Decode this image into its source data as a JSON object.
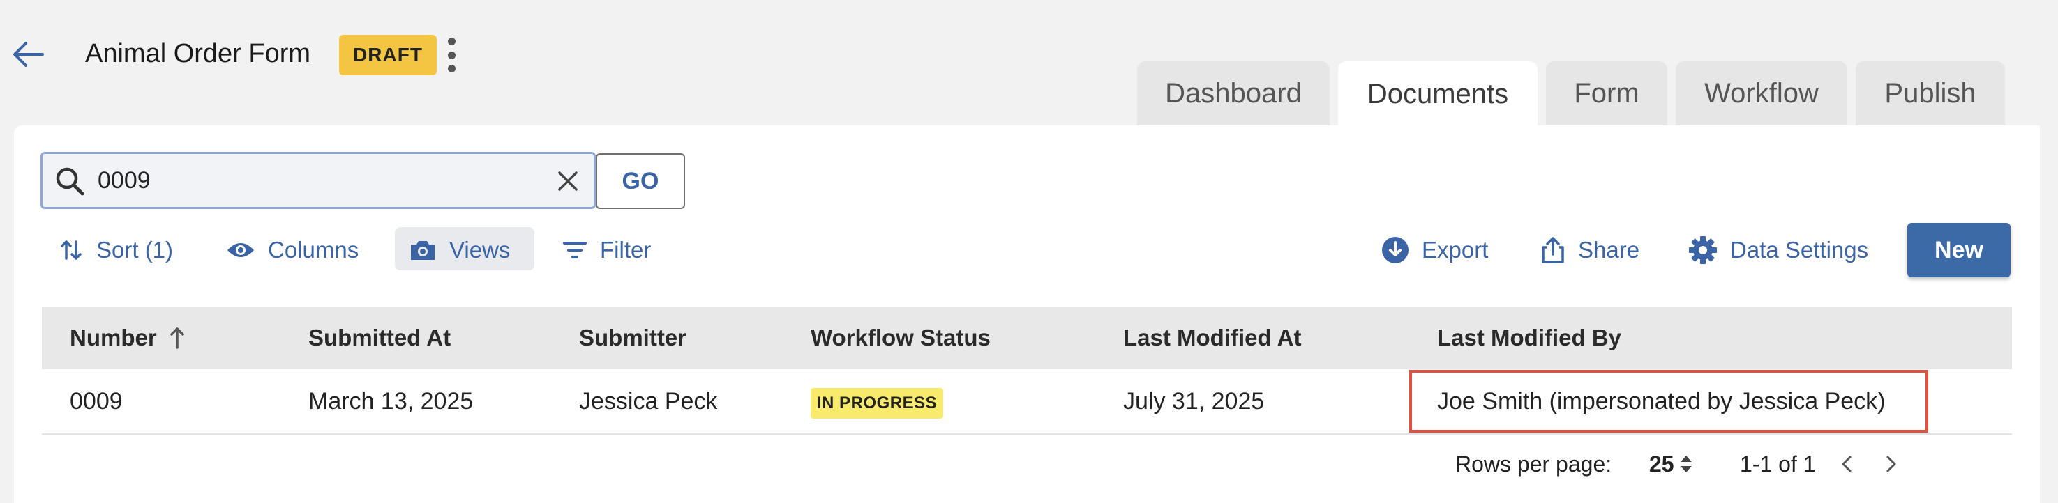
{
  "header": {
    "title": "Animal Order Form",
    "badge": "DRAFT"
  },
  "tabs": [
    {
      "label": "Dashboard",
      "active": false
    },
    {
      "label": "Documents",
      "active": true
    },
    {
      "label": "Form",
      "active": false
    },
    {
      "label": "Workflow",
      "active": false
    },
    {
      "label": "Publish",
      "active": false
    }
  ],
  "search": {
    "value": "0009",
    "go_label": "GO"
  },
  "toolbar": {
    "sort_label": "Sort (1)",
    "columns_label": "Columns",
    "views_label": "Views",
    "filter_label": "Filter",
    "export_label": "Export",
    "share_label": "Share",
    "data_settings_label": "Data Settings",
    "new_label": "New"
  },
  "table": {
    "headers": [
      "Number",
      "Submitted At",
      "Submitter",
      "Workflow Status",
      "Last Modified At",
      "Last Modified By"
    ],
    "rows": [
      [
        "0009",
        "March 13, 2025",
        "Jessica Peck",
        "IN PROGRESS",
        "July 31, 2025",
        "Joe Smith (impersonated by Jessica Peck)"
      ]
    ]
  },
  "pagination": {
    "rows_per_page_label": "Rows per page:",
    "rows_per_page_value": "25",
    "range": "1-1 of 1"
  },
  "colors": {
    "accent": "#3b6aa7",
    "draft_badge": "#f4c542",
    "status_badge": "#f7ea6c",
    "highlight": "#e0513f"
  }
}
